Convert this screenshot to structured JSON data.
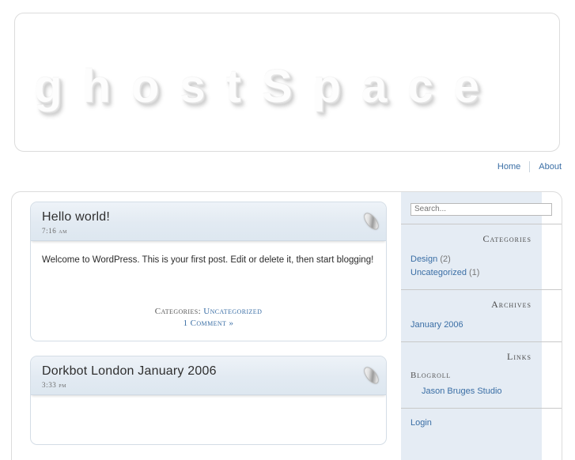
{
  "site": {
    "title": "ghostSpace"
  },
  "nav": {
    "items": [
      {
        "label": "Home"
      },
      {
        "label": "About"
      }
    ]
  },
  "posts": [
    {
      "title": "Hello world!",
      "time": "7:16 am",
      "body": "Welcome to WordPress. This is your first post. Edit or delete it, then start blogging!",
      "icon": "pen-ellipse-icon",
      "meta": {
        "categories_label": "Categories:",
        "category": "Uncategorized",
        "comments": "1 Comment »"
      }
    },
    {
      "title": "Dorkbot London January 2006",
      "time": "3:33 pm",
      "icon": "pen-ellipse-icon"
    }
  ],
  "sidebar": {
    "search": {
      "placeholder": "Search...",
      "value": ""
    },
    "categories": {
      "heading": "Categories",
      "items": [
        {
          "name": "Design",
          "count": "(2)"
        },
        {
          "name": "Uncategorized",
          "count": "(1)"
        }
      ]
    },
    "archives": {
      "heading": "Archives",
      "items": [
        {
          "name": "January 2006"
        }
      ]
    },
    "links": {
      "heading": "Links",
      "subheading": "Blogroll",
      "items": [
        {
          "name": "Jason Bruges Studio"
        }
      ]
    },
    "meta": {
      "items": [
        {
          "name": "Login"
        }
      ]
    }
  },
  "colors": {
    "link": "#3a6ea5",
    "sidebar_bg": "#e5ecf4",
    "post_header_bg": "#e2eaf2",
    "border": "#dcdcdc"
  }
}
